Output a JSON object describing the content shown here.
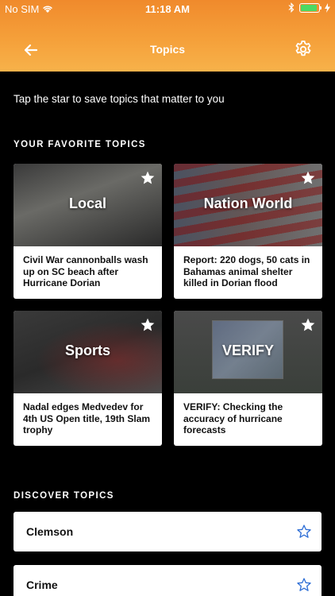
{
  "status": {
    "carrier": "No SIM",
    "time": "11:18 AM",
    "battery_level": 0.9
  },
  "nav": {
    "title": "Topics",
    "back_icon": "arrow-left-icon",
    "settings_icon": "gear-icon"
  },
  "intro": "Tap the star to save topics that matter to you",
  "favorites": {
    "heading": "YOUR FAVORITE TOPICS",
    "cards": [
      {
        "topic": "Local",
        "headline": "Civil War cannonballs wash up on SC beach after Hurricane Dorian",
        "starred": true
      },
      {
        "topic": "Nation World",
        "headline": "Report: 220 dogs, 50 cats in Bahamas animal shelter killed in Dorian flood",
        "starred": true
      },
      {
        "topic": "Sports",
        "headline": "Nadal edges Medvedev for 4th US Open title, 19th Slam trophy",
        "starred": true
      },
      {
        "topic": "VERIFY",
        "headline": "VERIFY: Checking the accuracy of hurricane forecasts",
        "starred": true
      }
    ]
  },
  "discover": {
    "heading": "DISCOVER TOPICS",
    "items": [
      {
        "label": "Clemson",
        "starred": false
      },
      {
        "label": "Crime",
        "starred": false
      }
    ]
  },
  "colors": {
    "header_orange": "#f5a03a",
    "star_outline": "#2f6fd6",
    "background": "#000000"
  }
}
